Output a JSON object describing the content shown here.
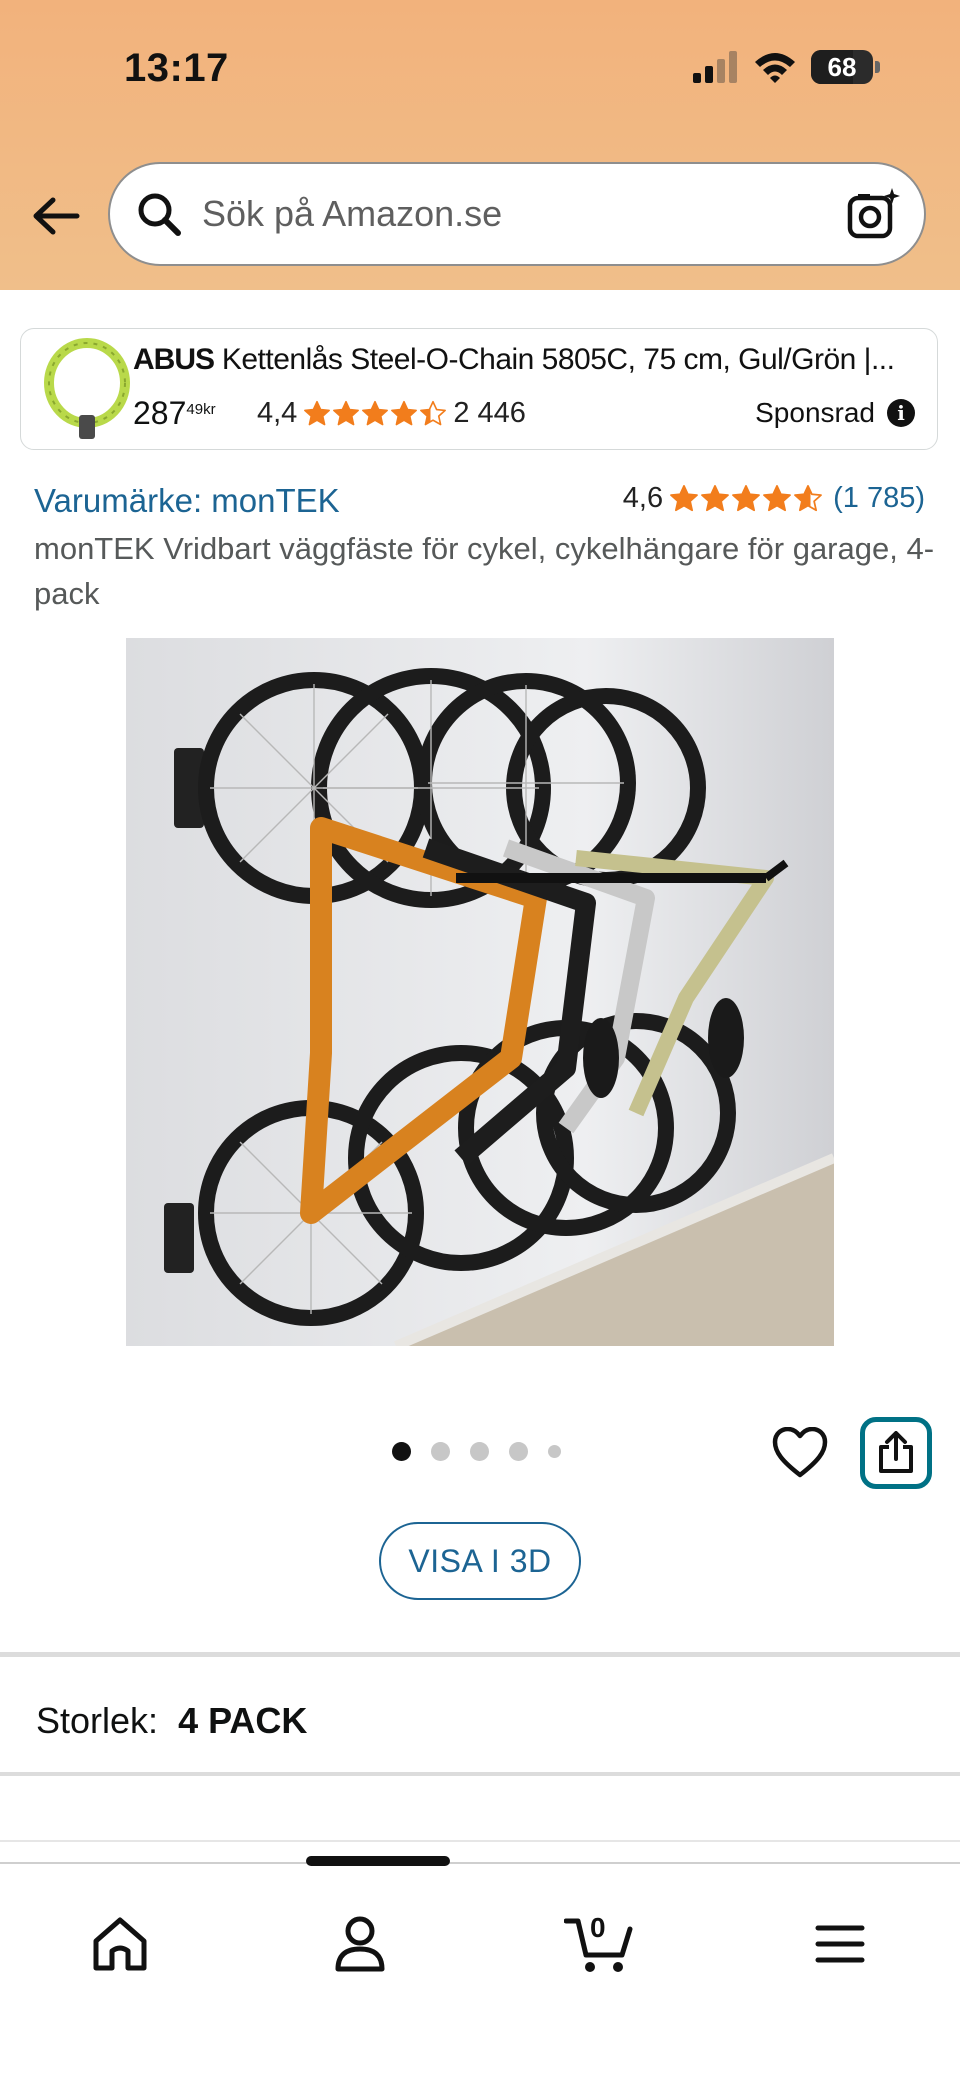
{
  "status_bar": {
    "time": "13:17",
    "battery": "68",
    "battery_level": 0.68
  },
  "search": {
    "placeholder": "Sök på Amazon.se"
  },
  "sponsored_ad": {
    "brand": "ABUS",
    "title": " Kettenlås Steel-O-Chain 5805C, 75 cm, Gul/Grön |...",
    "price_main": "287",
    "price_fraction": "49",
    "price_currency": "kr",
    "rating_value": "4,4",
    "rating_stars": 4.4,
    "review_count": "2 446",
    "sponsored_label": "Sponsrad"
  },
  "product": {
    "brand_link": "Varumärke: monTEK",
    "rating_value": "4,6",
    "rating_stars": 4.6,
    "review_count": "(1 785)",
    "title": "monTEK Vridbart väggfäste för cykel, cykelhängare för garage, 4-pack",
    "image_count": 5,
    "active_image_index": 0,
    "view_3d_label": "VISA I 3D"
  },
  "size": {
    "label": "Storlek:",
    "value": "4 PACK"
  },
  "bottom_nav": {
    "items": [
      "home-icon",
      "account-icon",
      "cart-icon",
      "menu-icon"
    ],
    "cart_count": "0"
  },
  "colors": {
    "header_bg": "#f2b27c",
    "link": "#1c6493",
    "star": "#f27d1c",
    "share_border": "#007185"
  }
}
